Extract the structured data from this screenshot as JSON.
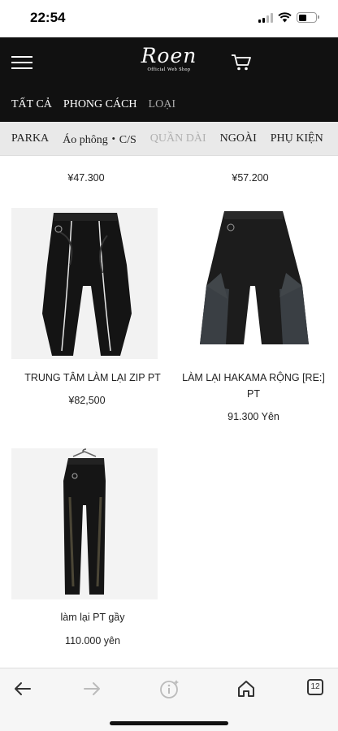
{
  "status": {
    "time": "22:54"
  },
  "header": {
    "logo": "Roen",
    "logo_sub": "Official Web Shop",
    "icons": [
      "menu-icon",
      "cart-icon"
    ]
  },
  "category_nav": [
    {
      "label": "TẤT CẢ",
      "active": false
    },
    {
      "label": "PHONG CÁCH",
      "active": false
    },
    {
      "label": "LOẠI",
      "active": true
    }
  ],
  "sub_nav": [
    {
      "label": "PARKA",
      "active": false
    },
    {
      "label": "Áo phông・C/S",
      "active": false
    },
    {
      "label": "QUẦN DÀI",
      "active": true
    },
    {
      "label": "NGOÀI",
      "active": false
    },
    {
      "label": "PHỤ KIỆN",
      "active": false
    }
  ],
  "products": [
    {
      "name": "",
      "price": "¥47.300"
    },
    {
      "name": "",
      "price": "¥57.200"
    },
    {
      "name": "TRUNG TÂM LÀM LẠI ZIP PT",
      "price": "¥82,500"
    },
    {
      "name_line1": "LÀM LẠI HAKAMA RỘNG [RE:]",
      "name_line2": "PT",
      "price": "91.300 Yên"
    },
    {
      "name": "làm lại PT gầy",
      "price": "110.000 yên"
    }
  ],
  "browser": {
    "tab_count": "12",
    "icons": [
      "back-arrow-icon",
      "forward-arrow-icon",
      "info-icon",
      "home-icon",
      "tabs-icon"
    ]
  },
  "colors": {
    "header_bg": "#111111",
    "subnav_bg": "#e9e9e9",
    "active_gray": "#b0b0b0"
  }
}
